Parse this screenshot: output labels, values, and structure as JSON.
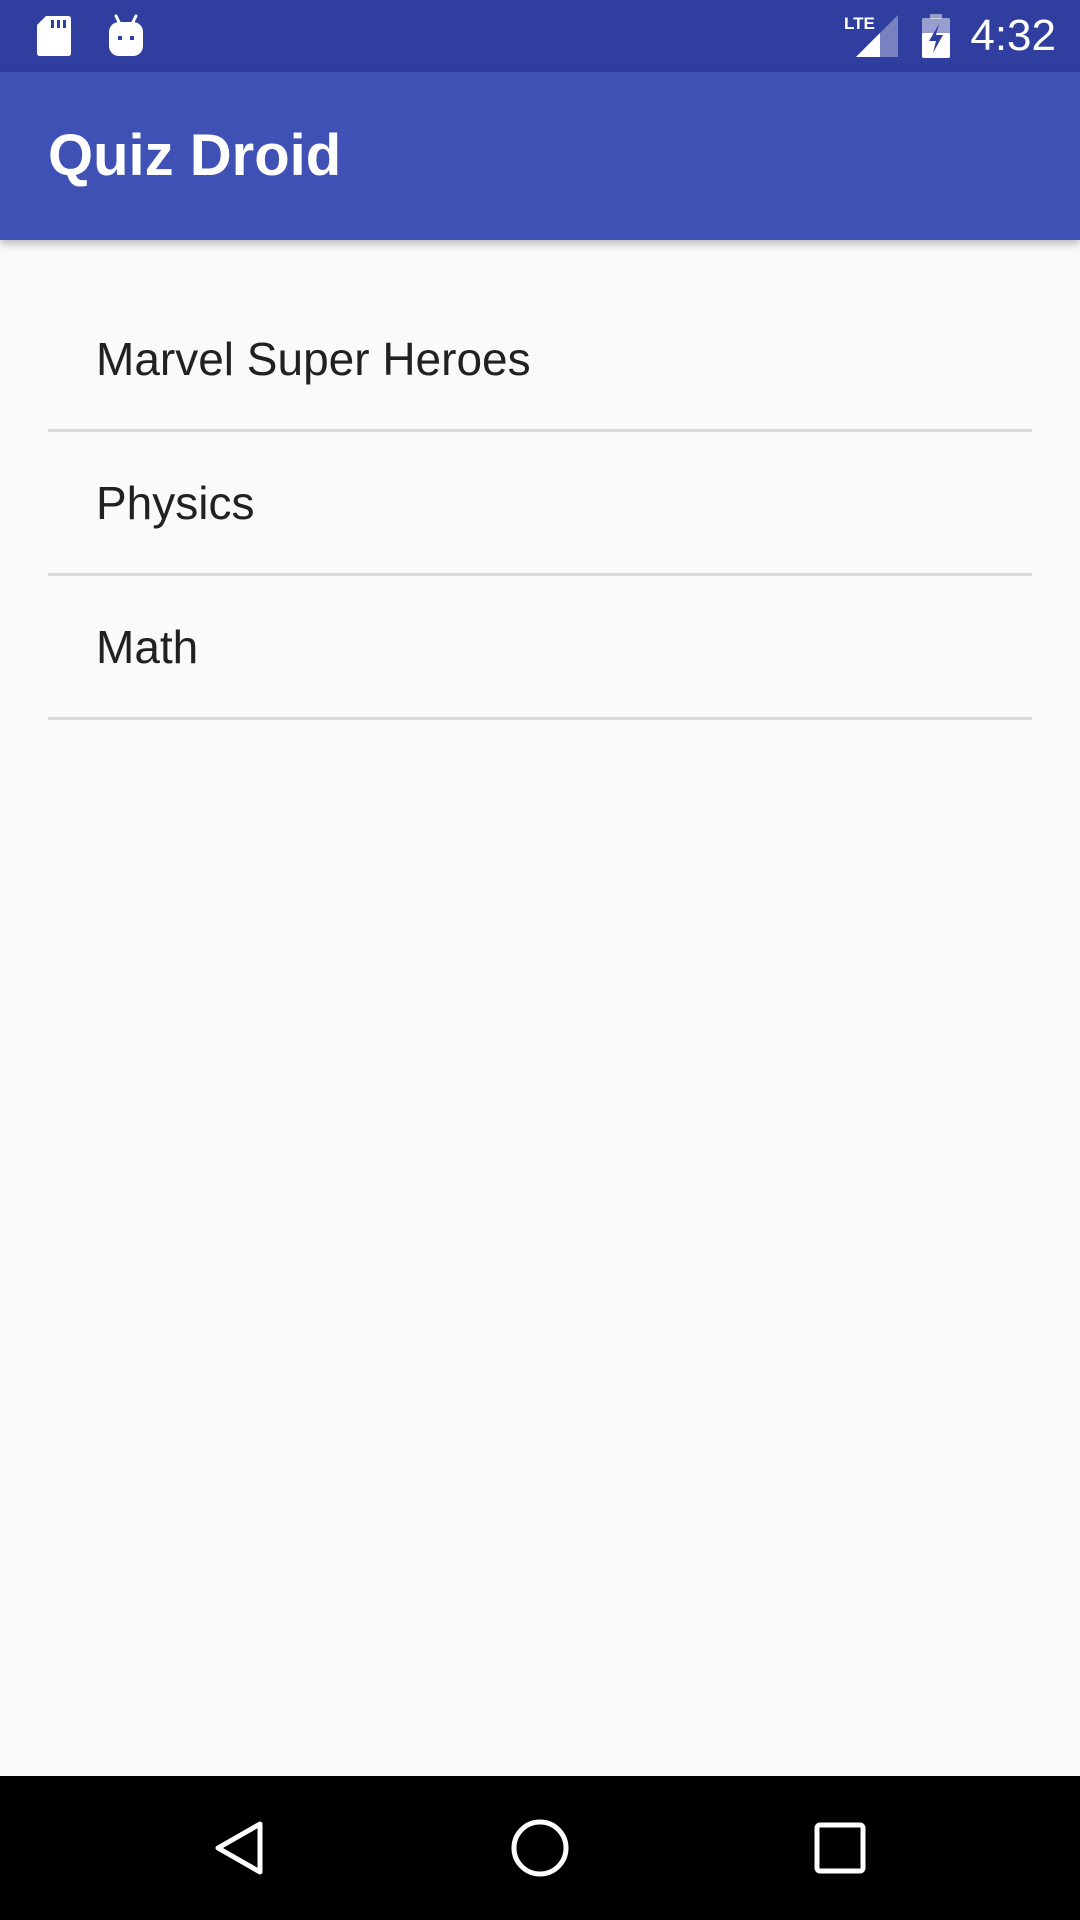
{
  "status_bar": {
    "time": "4:32",
    "network_label": "LTE",
    "icons": [
      "sd-card-icon",
      "android-debug-icon",
      "lte-signal-icon",
      "battery-charging-icon"
    ],
    "background_color": "#303f9f"
  },
  "app_bar": {
    "title": "Quiz Droid",
    "background_color": "#3f51b5"
  },
  "quiz_list": {
    "items": [
      {
        "label": "Marvel Super Heroes"
      },
      {
        "label": "Physics"
      },
      {
        "label": "Math"
      }
    ]
  },
  "nav_bar": {
    "icons": [
      "back-icon",
      "home-icon",
      "recents-icon"
    ]
  }
}
